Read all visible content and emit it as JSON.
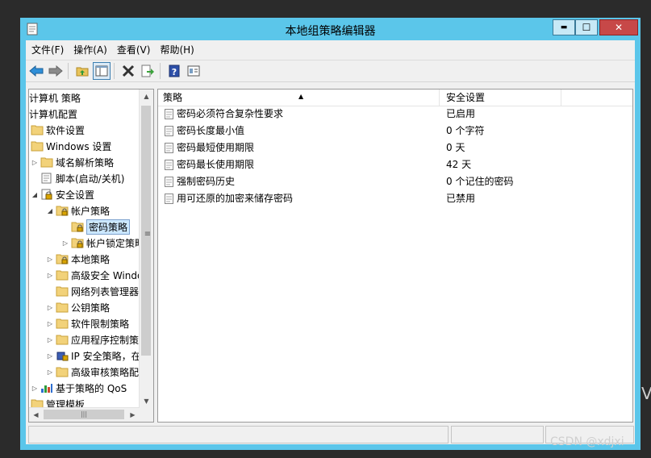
{
  "window": {
    "title": "本地组策略编辑器",
    "minimize_glyph": "▬",
    "maximize_glyph": "☐",
    "close_glyph": "✕"
  },
  "menu": [
    "文件(F)",
    "操作(A)",
    "查看(V)",
    "帮助(H)"
  ],
  "toolbar": {
    "buttons": [
      "back-icon",
      "forward-icon",
      "up-folder-icon",
      "show-hide-tree-icon",
      "delete-icon",
      "export-list-icon",
      "help-icon",
      "properties-icon"
    ]
  },
  "tree": {
    "items": [
      {
        "label": "计算机 策略",
        "depth": 0,
        "expander": "",
        "icon": "none"
      },
      {
        "label": "计算机配置",
        "depth": 0,
        "expander": "",
        "icon": "none"
      },
      {
        "label": "软件设置",
        "depth": 0,
        "expander": "",
        "icon": "folder"
      },
      {
        "label": "Windows 设置",
        "depth": 0,
        "expander": "",
        "icon": "folder"
      },
      {
        "label": "域名解析策略",
        "depth": 1,
        "expander": "▷",
        "icon": "folder"
      },
      {
        "label": "脚本(启动/关机)",
        "depth": 1,
        "expander": "",
        "icon": "script"
      },
      {
        "label": "安全设置",
        "depth": 1,
        "expander": "◢",
        "icon": "security"
      },
      {
        "label": "帐户策略",
        "depth": 2,
        "expander": "◢",
        "icon": "lock-folder"
      },
      {
        "label": "密码策略",
        "depth": 3,
        "expander": "",
        "icon": "lock-folder",
        "selected": true
      },
      {
        "label": "帐户锁定策略",
        "depth": 3,
        "expander": "▷",
        "icon": "lock-folder"
      },
      {
        "label": "本地策略",
        "depth": 2,
        "expander": "▷",
        "icon": "lock-folder"
      },
      {
        "label": "高级安全 Windo",
        "depth": 2,
        "expander": "▷",
        "icon": "folder"
      },
      {
        "label": "网络列表管理器",
        "depth": 2,
        "expander": "",
        "icon": "folder"
      },
      {
        "label": "公钥策略",
        "depth": 2,
        "expander": "▷",
        "icon": "folder"
      },
      {
        "label": "软件限制策略",
        "depth": 2,
        "expander": "▷",
        "icon": "folder"
      },
      {
        "label": "应用程序控制策",
        "depth": 2,
        "expander": "▷",
        "icon": "folder"
      },
      {
        "label": "IP 安全策略，在",
        "depth": 2,
        "expander": "▷",
        "icon": "ipsec"
      },
      {
        "label": "高级审核策略配",
        "depth": 2,
        "expander": "▷",
        "icon": "folder"
      },
      {
        "label": "基于策略的 QoS",
        "depth": 1,
        "expander": "▷",
        "icon": "chart"
      },
      {
        "label": "管理模板",
        "depth": 0,
        "expander": "",
        "icon": "folder"
      }
    ],
    "scroll_up": "▲",
    "scroll_down": "▼",
    "scroll_left": "◀",
    "scroll_right": "▶",
    "grip": "≡",
    "hgrip": "|||"
  },
  "list": {
    "columns": [
      "策略",
      "安全设置"
    ],
    "sort_indicator": "▲",
    "rows": [
      {
        "policy": "密码必须符合复杂性要求",
        "setting": "已启用"
      },
      {
        "policy": "密码长度最小值",
        "setting": "0 个字符"
      },
      {
        "policy": "密码最短使用期限",
        "setting": "0 天"
      },
      {
        "policy": "密码最长使用期限",
        "setting": "42 天"
      },
      {
        "policy": "强制密码历史",
        "setting": "0 个记住的密码"
      },
      {
        "policy": "用可还原的加密来储存密码",
        "setting": "已禁用"
      }
    ]
  },
  "watermark": "CSDN @xdjxi",
  "edge_text": "V",
  "colors": {
    "title_bar": "#5bc6ea",
    "close_button": "#c74848",
    "selection": "#cce8ff"
  }
}
